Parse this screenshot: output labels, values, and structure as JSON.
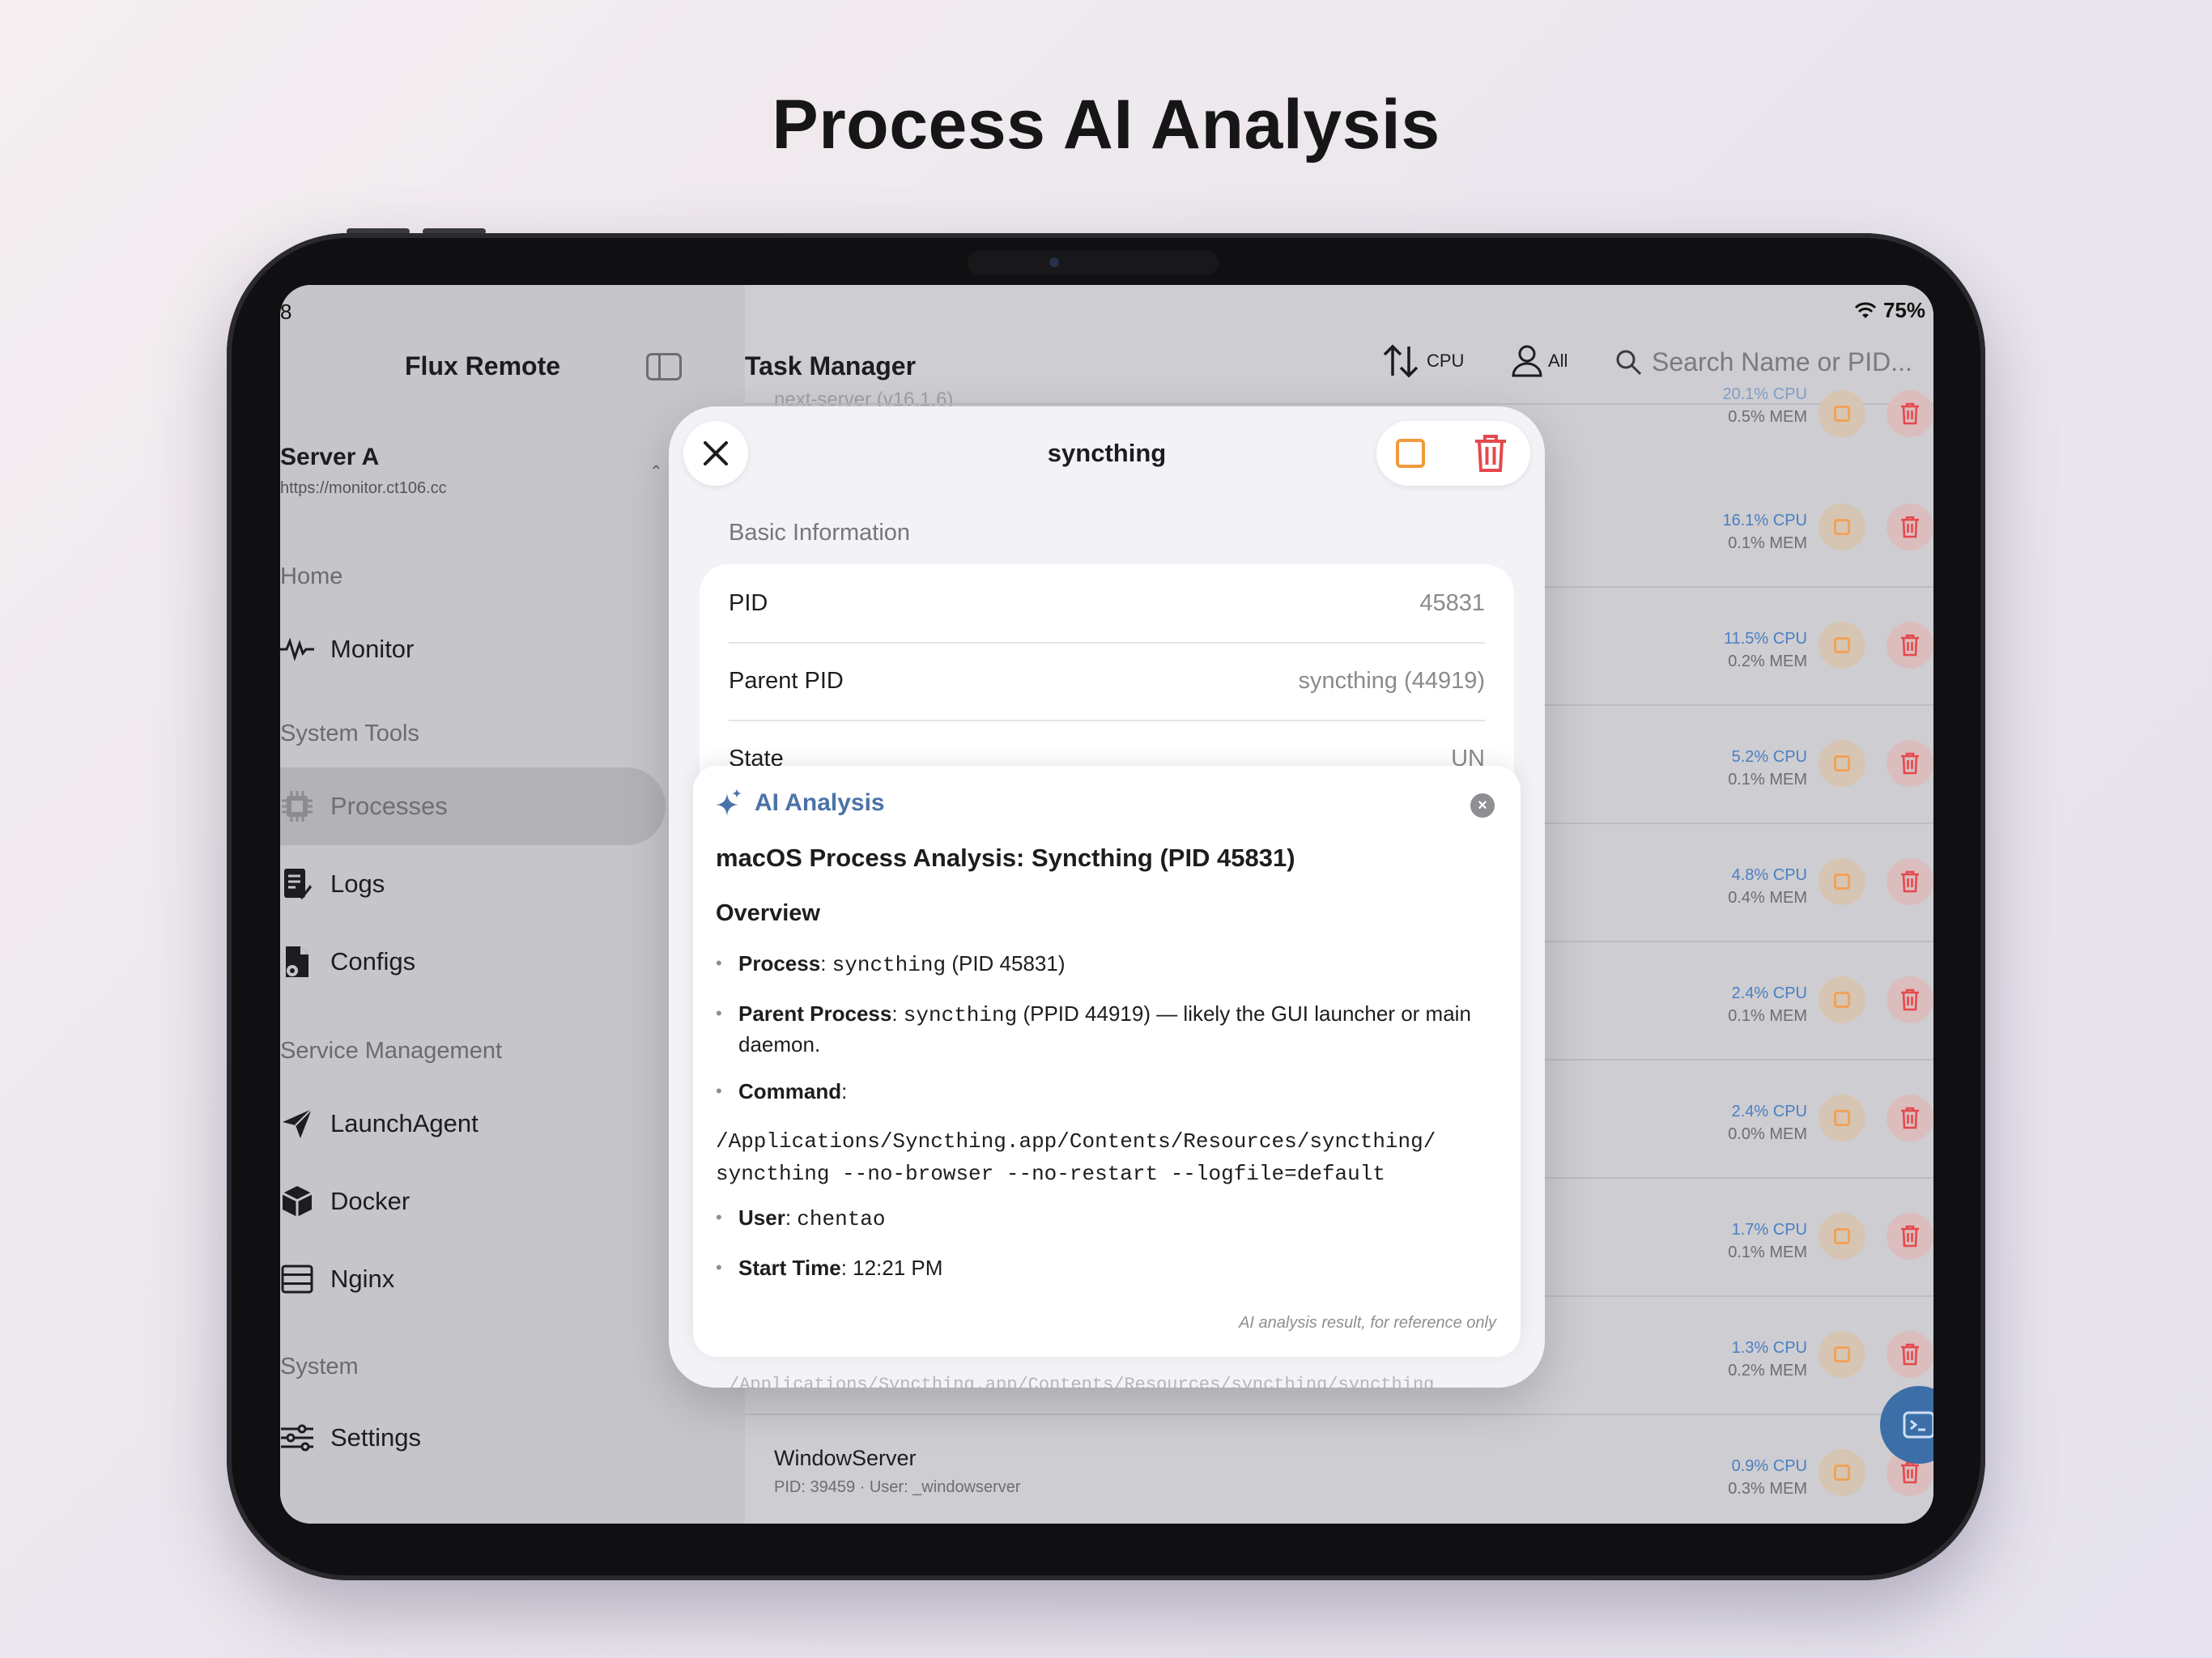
{
  "headline": "Process AI Analysis",
  "status": {
    "time": "8",
    "battery": "75%"
  },
  "sidebar": {
    "app_title": "Flux Remote",
    "server_name": "Server A",
    "server_url": "https://monitor.ct106.cc",
    "sections": {
      "home": "Home",
      "system_tools": "System Tools",
      "service_management": "Service Management",
      "system": "System"
    },
    "items": [
      {
        "label": "Monitor",
        "icon": "waveform-icon"
      },
      {
        "label": "Processes",
        "icon": "cpu-icon"
      },
      {
        "label": "Logs",
        "icon": "document-edit-icon"
      },
      {
        "label": "Configs",
        "icon": "config-file-icon"
      },
      {
        "label": "LaunchAgent",
        "icon": "paper-plane-icon"
      },
      {
        "label": "Docker",
        "icon": "cube-icon"
      },
      {
        "label": "Nginx",
        "icon": "server-rack-icon"
      },
      {
        "label": "Settings",
        "icon": "sliders-icon"
      }
    ]
  },
  "main": {
    "title": "Task Manager",
    "sort_label": "CPU",
    "user_filter_label": "All",
    "search_placeholder": "Search Name or PID...",
    "ghost_top": "next-server (v16.1.6)",
    "rows": [
      {
        "cpu": "20.1% CPU",
        "mem": "0.5% MEM"
      },
      {
        "cpu": "16.1% CPU",
        "mem": "0.1% MEM"
      },
      {
        "cpu": "11.5% CPU",
        "mem": "0.2% MEM"
      },
      {
        "cpu": "5.2% CPU",
        "mem": "0.1% MEM"
      },
      {
        "cpu": "4.8% CPU",
        "mem": "0.4% MEM"
      },
      {
        "cpu": "2.4% CPU",
        "mem": "0.1% MEM"
      },
      {
        "cpu": "2.4% CPU",
        "mem": "0.0% MEM"
      },
      {
        "cpu": "1.7% CPU",
        "mem": "0.1% MEM"
      },
      {
        "cpu": "1.3% CPU",
        "mem": "0.2% MEM"
      },
      {
        "name": "WindowServer",
        "meta": "PID: 39459 · User: _windowserver",
        "cpu": "0.9% CPU",
        "mem": "0.3% MEM"
      }
    ]
  },
  "modal": {
    "title": "syncthing",
    "section_label": "Basic Information",
    "info": [
      {
        "key": "PID",
        "value": "45831"
      },
      {
        "key": "Parent PID",
        "value": "syncthing (44919)"
      },
      {
        "key": "State",
        "value": "UN"
      }
    ],
    "ai": {
      "header": "AI Analysis",
      "heading": "macOS Process Analysis: Syncthing (PID 45831)",
      "subheading": "Overview",
      "process_label": "Process",
      "process_value": "syncthing",
      "process_suffix": "(PID 45831)",
      "parent_label": "Parent Process",
      "parent_value": "syncthing",
      "parent_suffix": "(PPID 44919) — likely the GUI launcher or main daemon.",
      "command_label": "Command",
      "command_line1": "/Applications/Syncthing.app/Contents/Resources/syncthing/",
      "command_line2": "syncthing --no-browser --no-restart --logfile=default",
      "user_label": "User",
      "user_value": "chentao",
      "start_label": "Start Time",
      "start_value": "12:21 PM",
      "footer": "AI analysis result, for reference only"
    },
    "bottom_ghost": "/Applications/Syncthing.app/Contents/Resources/syncthing/syncthing"
  },
  "colors": {
    "accent": "#4b73a8",
    "stop": "#f29a3d",
    "delete": "#e5484d",
    "cpu_text": "#4a7fc2"
  }
}
